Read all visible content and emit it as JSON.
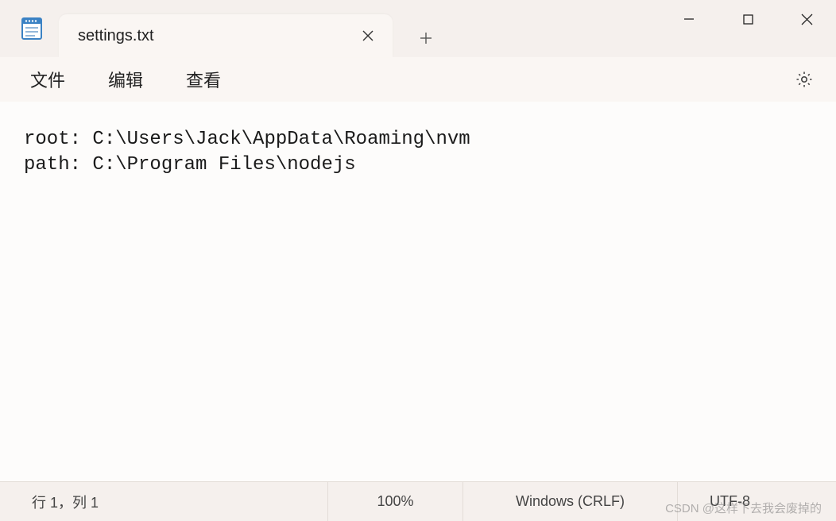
{
  "titlebar": {
    "tab_title": "settings.txt"
  },
  "menubar": {
    "file": "文件",
    "edit": "编辑",
    "view": "查看"
  },
  "editor": {
    "content": "root: C:\\Users\\Jack\\AppData\\Roaming\\nvm\npath: C:\\Program Files\\nodejs"
  },
  "statusbar": {
    "position": "行 1，列 1",
    "zoom": "100%",
    "eol": "Windows (CRLF)",
    "encoding": "UTF-8"
  },
  "watermark": "CSDN @这样下去我会废掉的"
}
